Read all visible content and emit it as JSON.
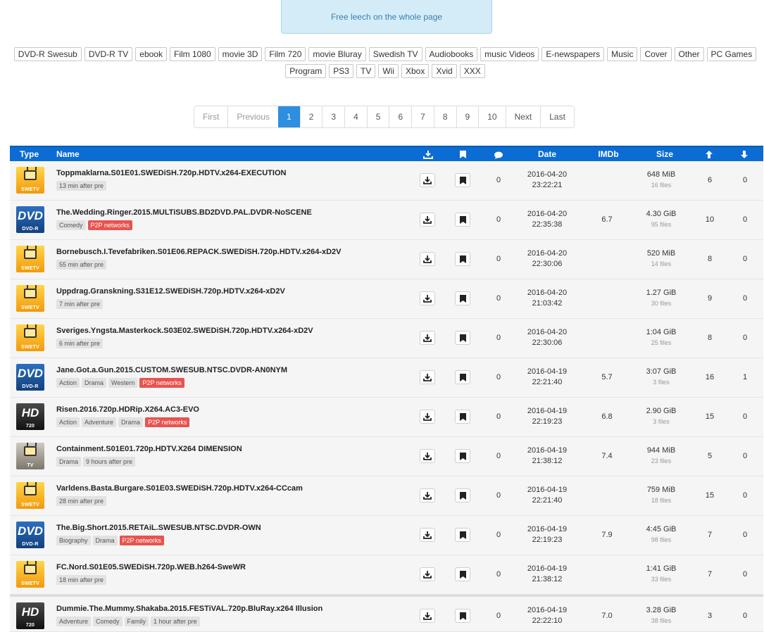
{
  "notice": "Free leech on the whole page",
  "categories": [
    "DVD-R Swesub",
    "DVD-R TV",
    "ebook",
    "Film 1080",
    "movie 3D",
    "Film 720",
    "movie Bluray",
    "Swedish TV",
    "Audiobooks",
    "music Videos",
    "E-newspapers",
    "Music",
    "Cover",
    "Other",
    "PC Games",
    "Program",
    "PS3",
    "TV",
    "Wii",
    "Xbox",
    "Xvid",
    "XXX"
  ],
  "pagination": {
    "first": "First",
    "previous": "Previous",
    "pages": [
      "1",
      "2",
      "3",
      "4",
      "5",
      "6",
      "7",
      "8",
      "9",
      "10"
    ],
    "current": "1",
    "next": "Next",
    "last": "Last"
  },
  "table": {
    "headers": {
      "type": "Type",
      "name": "Name",
      "date": "Date",
      "imdb": "IMDb",
      "size": "Size"
    },
    "header_icons": [
      "download-icon",
      "bookmark-icon",
      "comment-icon",
      "arrow-up-icon",
      "arrow-down-icon"
    ],
    "rows": [
      {
        "icon": "swetv",
        "icon_label": "SWETV",
        "name": "Toppmaklarna.S01E01.SWEDiSH.720p.HDTV.x264-EXECUTION",
        "tags": [
          "13 min after pre"
        ],
        "p2p": false,
        "comments": "0",
        "date": "2016-04-20",
        "time": "23:22:21",
        "imdb": "",
        "size": "648 MiB",
        "files": "16 files",
        "seeders": "6",
        "leechers": "0"
      },
      {
        "icon": "dvd",
        "icon_label": "DVD-R",
        "name": "The.Wedding.Ringer.2015.MULTiSUBS.BD2DVD.PAL.DVDR-NoSCENE",
        "tags": [
          "Comedy"
        ],
        "p2p": true,
        "comments": "0",
        "date": "2016-04-20",
        "time": "22:35:38",
        "imdb": "6.7",
        "size": "4.30 GiB",
        "files": "95 files",
        "seeders": "10",
        "leechers": "0"
      },
      {
        "icon": "swetv",
        "icon_label": "SWETV",
        "name": "Bornebusch.I.Tevefabriken.S01E06.REPACK.SWEDiSH.720p.HDTV.x264-xD2V",
        "tags": [
          "55 min after pre"
        ],
        "p2p": false,
        "comments": "0",
        "date": "2016-04-20",
        "time": "22:30:06",
        "imdb": "",
        "size": "520 MiB",
        "files": "14 files",
        "seeders": "8",
        "leechers": "0"
      },
      {
        "icon": "swetv",
        "icon_label": "SWETV",
        "name": "Uppdrag.Granskning.S31E12.SWEDiSH.720p.HDTV.x264-xD2V",
        "tags": [
          "7 min after pre"
        ],
        "p2p": false,
        "comments": "0",
        "date": "2016-04-20",
        "time": "21:03:42",
        "imdb": "",
        "size": "1.27 GiB",
        "files": "30 files",
        "seeders": "9",
        "leechers": "0"
      },
      {
        "icon": "swetv",
        "icon_label": "SWETV",
        "name": "Sveriges.Yngsta.Masterkock.S03E02.SWEDiSH.720p.HDTV.x264-xD2V",
        "tags": [
          "6 min after pre"
        ],
        "p2p": false,
        "comments": "0",
        "date": "2016-04-20",
        "time": "22:30:06",
        "imdb": "",
        "size": "1:04 GiB",
        "files": "25 files",
        "seeders": "8",
        "leechers": "0"
      },
      {
        "icon": "dvd",
        "icon_label": "DVD-R",
        "name": "Jane.Got.a.Gun.2015.CUSTOM.SWESUB.NTSC.DVDR-AN0NYM",
        "tags": [
          "Action",
          "Drama",
          "Western"
        ],
        "p2p": true,
        "comments": "0",
        "date": "2016-04-19",
        "time": "22:21:40",
        "imdb": "5.7",
        "size": "3:07 GiB",
        "files": "3 files",
        "seeders": "16",
        "leechers": "1"
      },
      {
        "icon": "hd",
        "icon_label": "720",
        "name": "Risen.2016.720p.HDRip.X264.AC3-EVO",
        "tags": [
          "Action",
          "Adventure",
          "Drama"
        ],
        "p2p": true,
        "comments": "0",
        "date": "2016-04-19",
        "time": "22:19:23",
        "imdb": "6.8",
        "size": "2.90 GiB",
        "files": "3 files",
        "seeders": "15",
        "leechers": "0"
      },
      {
        "icon": "tv",
        "icon_label": "TV",
        "name": "Containment.S01E01.720p.HDTV.X264 DIMENSION",
        "tags": [
          "Drama",
          "9 hours after pre"
        ],
        "p2p": false,
        "comments": "0",
        "date": "2016-04-19",
        "time": "21:38:12",
        "imdb": "7.4",
        "size": "944 MiB",
        "files": "23 files",
        "seeders": "5",
        "leechers": "0"
      },
      {
        "icon": "swetv",
        "icon_label": "SWETV",
        "name": "Varldens.Basta.Burgare.S01E03.SWEDiSH.720p.HDTV.x264-CCcam",
        "tags": [
          "28 min after pre"
        ],
        "p2p": false,
        "comments": "0",
        "date": "2016-04-19",
        "time": "22:21:40",
        "imdb": "",
        "size": "759 MiB",
        "files": "18 files",
        "seeders": "15",
        "leechers": "0"
      },
      {
        "icon": "dvd",
        "icon_label": "DVD-R",
        "name": "The.Big.Short.2015.RETAiL.SWESUB.NTSC.DVDR-OWN",
        "tags": [
          "Biography",
          "Drama"
        ],
        "p2p": true,
        "comments": "0",
        "date": "2016-04-19",
        "time": "22:19:23",
        "imdb": "7.9",
        "size": "4:45 GiB",
        "files": "98 files",
        "seeders": "7",
        "leechers": "0"
      },
      {
        "icon": "swetv",
        "icon_label": "SWETV",
        "name": "FC.Nord.S01E05.SWEDiSH.720p.WEB.h264-SweWR",
        "tags": [
          "18 min after pre"
        ],
        "p2p": false,
        "comments": "0",
        "date": "2016-04-19",
        "time": "21:38:12",
        "imdb": "",
        "size": "1:41 GiB",
        "files": "33 files",
        "seeders": "7",
        "leechers": "0"
      },
      {
        "icon": "hd",
        "icon_label": "720",
        "name": "Dummie.The.Mummy.Shakaba.2015.FESTiVAL.720p.BluRay.x264 Illusion",
        "tags": [
          "Adventure",
          "Comedy",
          "Family",
          "1 hour after pre"
        ],
        "p2p": false,
        "comments": "0",
        "date": "2016-04-19",
        "time": "22:22:10",
        "imdb": "7.0",
        "size": "3.28 GiB",
        "files": "38 files",
        "seeders": "3",
        "leechers": "0"
      }
    ],
    "p2p_label": "P2P networks"
  },
  "colors": {
    "header_bg": "#0b6cd3",
    "active_page": "#2e8ee0",
    "p2p_tag": "#e9534f",
    "notice_bg": "#d4ecf7"
  }
}
